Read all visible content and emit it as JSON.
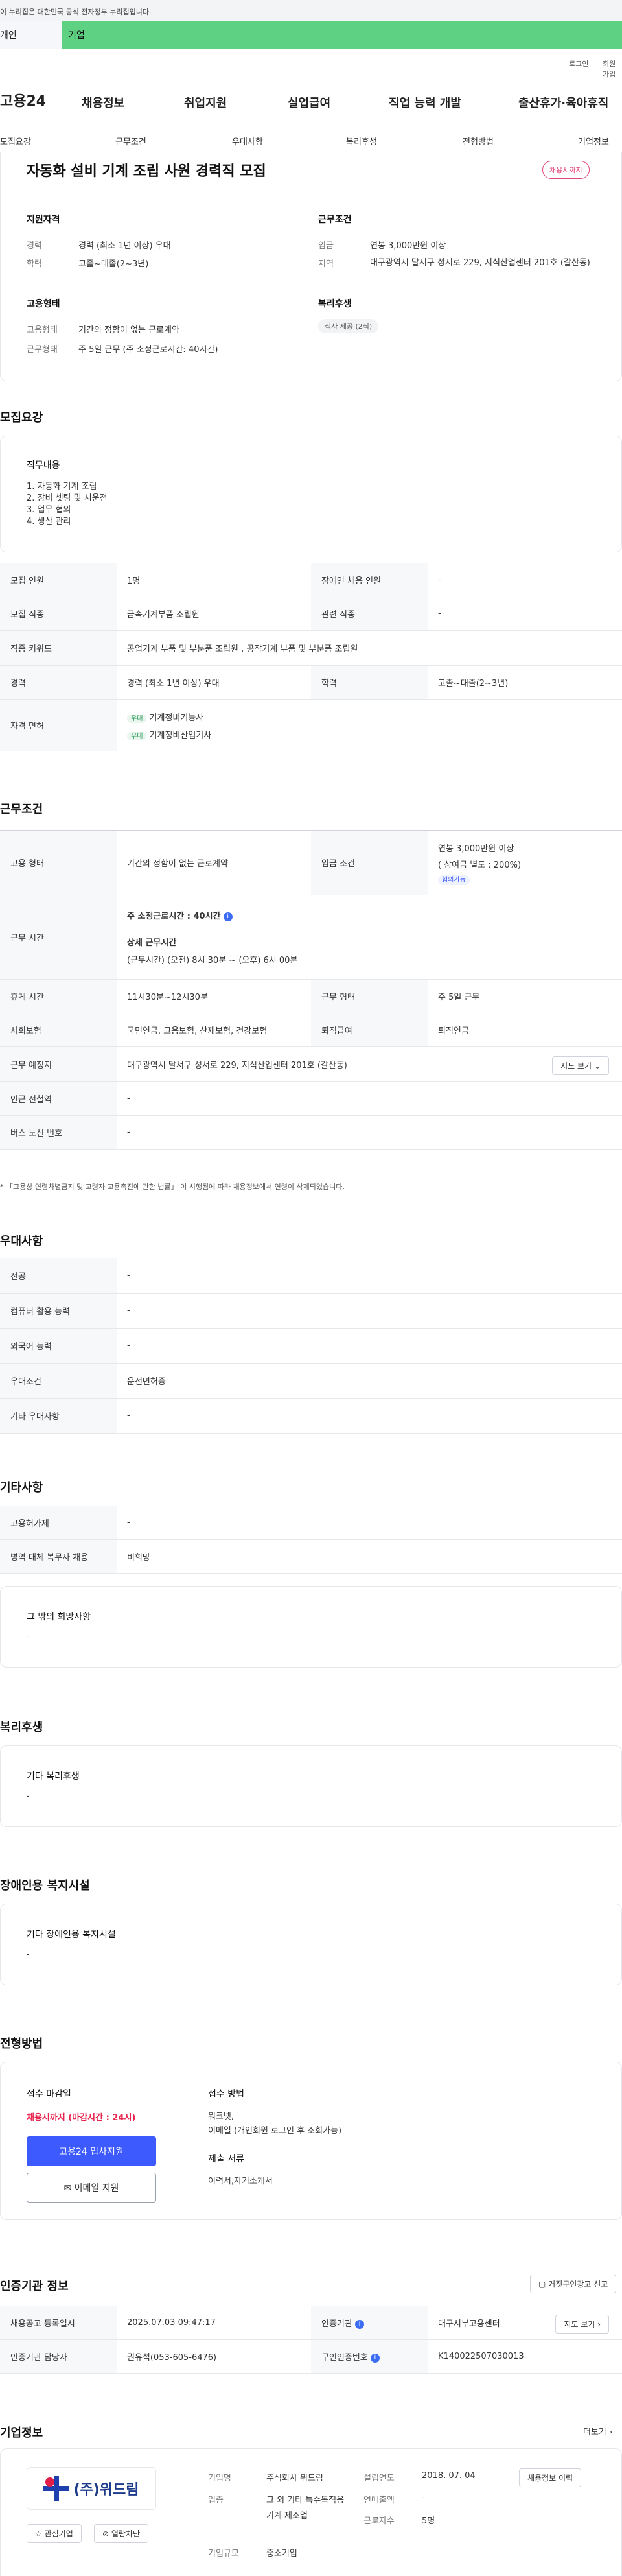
{
  "gov_banner": "이 누리집은 대한민국 공식 전자정부 누리집입니다.",
  "top_tabs": [
    "개인",
    "기업"
  ],
  "util_links": [
    "로그인",
    "회원가입"
  ],
  "logo": "고용24",
  "main_menu": [
    "채용정보",
    "취업지원",
    "실업급여",
    "직업 능력 개발",
    "출산휴가·육아휴직"
  ],
  "sub_nav": [
    "모집요강",
    "근무조건",
    "우대사항",
    "복리후생",
    "전형방법",
    "기업정보"
  ],
  "summary": {
    "title": "자동화 설비 기계 조립 사원 경력직 모집",
    "badge": "채용시까지",
    "qual_heading": "지원자격",
    "qual_rows": [
      {
        "label": "경력",
        "value": "경력 (최소 1년 이상) 우대"
      },
      {
        "label": "학력",
        "value": "고졸~대졸(2~3년)"
      }
    ],
    "cond_heading": "근무조건",
    "cond_rows": [
      {
        "label": "임금",
        "value": "연봉 3,000만원 이상"
      },
      {
        "label": "지역",
        "value": "대구광역시 달서구 성서로 229, 지식산업센터 201호 (갈산동)"
      }
    ],
    "emp_heading": "고용형태",
    "emp_rows": [
      {
        "label": "고용형태",
        "value": "기간의 정함이 없는 근로계약"
      },
      {
        "label": "근무형태",
        "value": "주 5일 근무 (주 소정근로시간: 40시간)"
      }
    ],
    "welfare_heading": "복리후생",
    "welfare_chip": "식사 제공 (2식)"
  },
  "recruit": {
    "heading": "모집요강",
    "duty_heading": "직무내용",
    "duties": [
      "1. 자동화 기계 조립",
      "2. 장비 셋팅 및 시운전",
      "3. 업무 협의",
      "4. 생산 관리"
    ],
    "rows": {
      "headcount_label": "모집 인원",
      "headcount": "1명",
      "disabled_label": "장애인 채용 인원",
      "disabled": "-",
      "job_label": "모집 직종",
      "job": "금속기계부품 조립원",
      "related_label": "관련 직종",
      "related": "-",
      "keyword_label": "직종 키워드",
      "keyword": "공업기계 부품 및 부분품 조립원 , 공작기계 부품 및 부분품 조립원",
      "career_label": "경력",
      "career": "경력 (최소 1년 이상) 우대",
      "edu_label": "학력",
      "edu": "고졸~대졸(2~3년)",
      "license_label": "자격 면허",
      "licenses": [
        {
          "tag": "우대",
          "name": "기계정비기능사"
        },
        {
          "tag": "우대",
          "name": "기계정비산업기사"
        }
      ]
    }
  },
  "work": {
    "heading": "근무조건",
    "emp_type_label": "고용 형태",
    "emp_type": "기간의 정함이 없는 근로계약",
    "wage_label": "임금 조건",
    "wage": "연봉 3,000만원 이상",
    "wage_note": "( 상여금 별도 : 200%)",
    "wage_chip": "협의가능",
    "hours_label": "근무 시간",
    "hours_main": "주 소정근로시간 : 40시간",
    "hours_detail_title": "상세 근무시간",
    "hours_detail": "(근무시간) (오전) 8시 30분 ~ (오후) 6시 00분",
    "break_label": "휴게 시간",
    "break": "11시30분~12시30분",
    "type_label": "근무 형태",
    "type": "주 5일 근무",
    "insurance_label": "사회보험",
    "insurance": "국민연금, 고용보험, 산재보험, 건강보험",
    "retire_label": "퇴직급여",
    "retire": "퇴직연금",
    "place_label": "근무 예정지",
    "place": "대구광역시 달서구 성서로 229, 지식산업센터 201호 (갈산동)",
    "map_button": "지도 보기",
    "subway_label": "인근 전철역",
    "subway": "-",
    "bus_label": "버스 노선 번호",
    "bus": "-",
    "notice": "* 「고용상 연령차별금지 및 고령자 고용촉진에 관한 법률」 이 시행됨에 따라 채용정보에서 연령이 삭제되었습니다."
  },
  "pref": {
    "heading": "우대사항",
    "rows": [
      {
        "label": "전공",
        "value": "-"
      },
      {
        "label": "컴퓨터 활용 능력",
        "value": "-"
      },
      {
        "label": "외국어 능력",
        "value": "-"
      },
      {
        "label": "우대조건",
        "value": "운전면허증"
      },
      {
        "label": "기타 우대사항",
        "value": "-"
      }
    ]
  },
  "etc": {
    "heading": "기타사항",
    "rows": [
      {
        "label": "고용허가제",
        "value": "-"
      },
      {
        "label": "병역 대체 복무자 채용",
        "value": "비희망"
      }
    ],
    "other_heading": "그 밖의 희망사항",
    "other_value": "-"
  },
  "welfare": {
    "heading": "복리후생",
    "box_heading": "기타 복리후생",
    "box_value": "-"
  },
  "facility": {
    "heading": "장애인용 복지시설",
    "box_heading": "기타 장애인용 복지시설",
    "box_value": "-"
  },
  "screening": {
    "heading": "전형방법",
    "deadline_heading": "접수 마감일",
    "deadline": "채용시까지 (마감시간 : 24시)",
    "apply_button": "고용24 입사지원",
    "email_button": "이메일 지원",
    "method_heading": "접수 방법",
    "method": "워크넷,",
    "method2": "이메일 (개인회원 로그인 후 조회가능)",
    "docs_heading": "제출 서류",
    "docs": "이력서,자기소개서"
  },
  "cert": {
    "heading": "인증기관 정보",
    "report_button": "거짓구인광고 신고",
    "reg_label": "채용공고 등록일시",
    "reg": "2025.07.03 09:47:17",
    "org_label": "인증기관",
    "org": "대구서부고용센터",
    "org_button": "지도 보기",
    "mgr_label": "인증기관 담당자",
    "mgr": "권유석(053-605-6476)",
    "no_label": "구인인증번호",
    "no": "K140022507030013"
  },
  "company": {
    "heading": "기업정보",
    "more": "더보기",
    "logo_text": "(주)위드림",
    "fav_button": "관심기업",
    "block_button": "열람차단",
    "name_label": "기업명",
    "name": "주식회사 위드림",
    "year_label": "설립연도",
    "year": "2018. 07. 04",
    "industry_label": "업종",
    "industry": "그 외 기타 특수목적용 기계 제조업",
    "sales_label": "연매출액",
    "sales": "-",
    "emp_label": "근로자수",
    "emp": "5명",
    "size_label": "기업규모",
    "size": "중소기업",
    "jobs_button": "채용정보 이력"
  }
}
